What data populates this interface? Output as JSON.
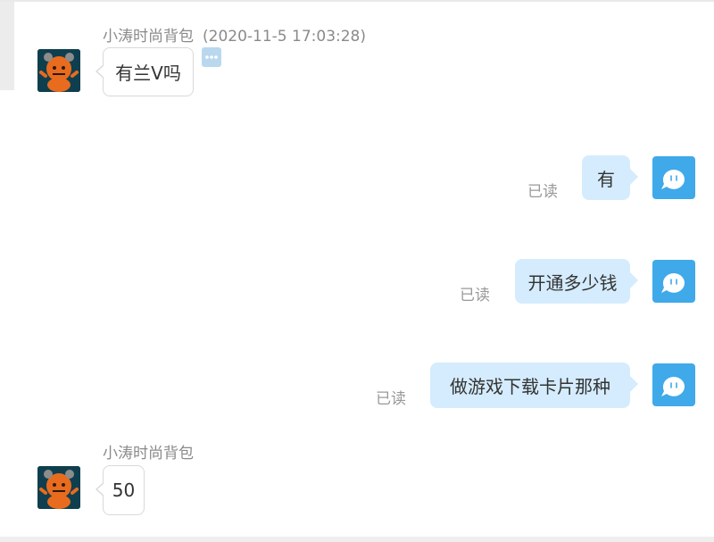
{
  "messages": [
    {
      "sender": "小涛时尚背包",
      "time": "(2020-11-5 17:03:28)",
      "text": "有兰V吗"
    },
    {
      "text": "有",
      "status": "已读"
    },
    {
      "text": "开通多少钱",
      "status": "已读"
    },
    {
      "text": "做游戏下载卡片那种",
      "status": "已读"
    },
    {
      "sender": "小涛时尚背包",
      "text": "50"
    }
  ],
  "icons": {
    "more": "more-dots-icon",
    "seller_avatar": "pumpkin-avatar",
    "self_avatar": "chat-bubble-face-avatar"
  },
  "colors": {
    "outgoing_bubble": "#d4ecfd",
    "incoming_bubble": "#ffffff",
    "self_avatar": "#3fa9ea",
    "meta_text": "#8a8a8a"
  }
}
